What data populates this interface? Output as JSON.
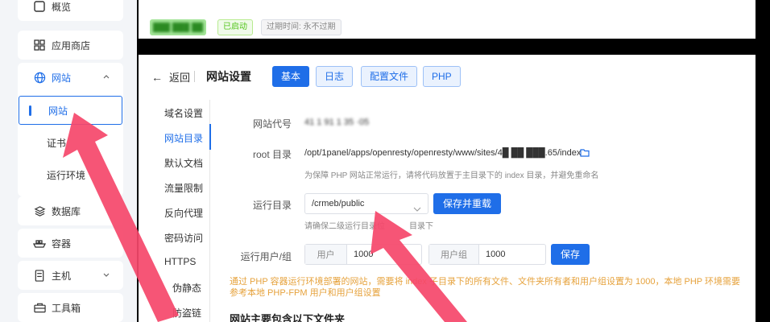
{
  "sidebar": {
    "top_partial": {
      "label": "概览"
    },
    "app_store": {
      "label": "应用商店"
    },
    "websites": {
      "label": "网站"
    },
    "website": {
      "label": "网站"
    },
    "certificate": {
      "label": "证书"
    },
    "runtime": {
      "label": "运行环境"
    },
    "database": {
      "label": "数据库"
    },
    "container": {
      "label": "容器"
    },
    "host": {
      "label": "主机"
    },
    "toolbox": {
      "label": "工具箱"
    }
  },
  "topbar": {
    "site_name": "███ ███ ██",
    "status": "已启动",
    "expire": "过期时间: 永不过期"
  },
  "header": {
    "back_label": "返回",
    "title": "网站设置",
    "tabs": [
      "基本",
      "日志",
      "配置文件",
      "PHP"
    ]
  },
  "subnav": [
    "域名设置",
    "网站目录",
    "默认文档",
    "流量限制",
    "反向代理",
    "密码访问",
    "HTTPS",
    "伪静态",
    "防盗链"
  ],
  "form": {
    "site_code_label": "网站代号",
    "site_code_value": "41 1 91 1 35 ·05",
    "root_label": "root 目录",
    "root_value": "/opt/1panel/apps/openresty/openresty/www/sites/4█ ██ ███.65/index",
    "root_hint": "为保障 PHP 网站正常运行，请将代码放置于主目录下的 index 目录，并避免重命名",
    "run_dir_label": "运行目录",
    "run_dir_value": "/crmeb/public",
    "save_reload": "保存并重载",
    "run_dir_hint": "请确保二级运行目录位",
    "run_dir_hint_tail": "目录下",
    "user_group_label": "运行用户/组",
    "user_prefix": "用户",
    "user_value": "1000",
    "group_prefix": "用户组",
    "group_value": "1000",
    "save": "保存",
    "warning": "通过 PHP 容器运行环境部署的网站，需要将 index 子目录下的所有文件、文件夹所有者和用户组设置为 1000，本地 PHP 环境需要参考本地 PHP-FPM 用户和用户组设置",
    "section_title": "网站主要包含以下文件夹"
  },
  "colors": {
    "accent": "#1f6ee8",
    "arrow": "#f5466a",
    "warning": "#e6a23c",
    "success": "#52c41a"
  }
}
